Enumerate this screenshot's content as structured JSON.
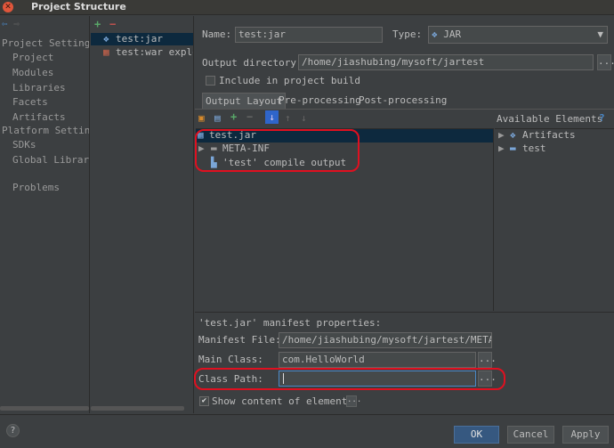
{
  "window": {
    "title": "Project Structure"
  },
  "nav": {
    "project_settings_header": "Project Setting",
    "project_items": [
      "Project",
      "Modules",
      "Libraries",
      "Facets",
      "Artifacts"
    ],
    "platform_settings_header": "Platform Settin",
    "platform_items": [
      "SDKs",
      "Global Librarie"
    ],
    "other_items": [
      "Problems"
    ]
  },
  "artifacts": {
    "add_label": "+",
    "remove_label": "−",
    "items": [
      {
        "label": "test:jar",
        "icon": "jar-icon",
        "selected": true
      },
      {
        "label": "test:war explode",
        "icon": "war-icon",
        "selected": false
      }
    ]
  },
  "artifact_form": {
    "name_label": "Name:",
    "name_value": "test:jar",
    "type_label": "Type:",
    "type_value": "JAR",
    "output_dir_label": "Output directory:",
    "output_dir_value": "/home/jiashubing/mysoft/jartest",
    "include_in_build_label": "Include in project build",
    "include_in_build_checked": false,
    "tabs": [
      "Output Layout",
      "Pre-processing",
      "Post-processing"
    ],
    "active_tab": "Output Layout",
    "available_elements_label": "Available Elements",
    "available_help": "?"
  },
  "layout_tree": [
    {
      "label": "test.jar",
      "indent": 0,
      "expandable": false,
      "icon": "jar-icon",
      "selected": true
    },
    {
      "label": "META-INF",
      "indent": 1,
      "expandable": true,
      "icon": "folder-icon",
      "selected": false
    },
    {
      "label": "'test' compile output",
      "indent": 1,
      "expandable": false,
      "icon": "module-output-icon",
      "selected": false
    }
  ],
  "available_tree": [
    {
      "label": "Artifacts",
      "icon": "artifact-icon"
    },
    {
      "label": "test",
      "icon": "module-folder-icon"
    }
  ],
  "manifest": {
    "header": "'test.jar' manifest properties:",
    "file_label": "Manifest File:",
    "file_value": "/home/jiashubing/mysoft/jartest/META-IN",
    "main_class_label": "Main Class:",
    "main_class_value": "com.HelloWorld",
    "class_path_label": "Class Path:",
    "class_path_value": "",
    "show_content_label": "Show content of elements",
    "show_content_checked": true,
    "browse_label": "..."
  },
  "buttons": {
    "ok": "OK",
    "cancel": "Cancel",
    "apply": "Apply",
    "help": "?"
  },
  "colors": {
    "accent_red_ring": "#e01020",
    "selection": "#0d293e"
  }
}
